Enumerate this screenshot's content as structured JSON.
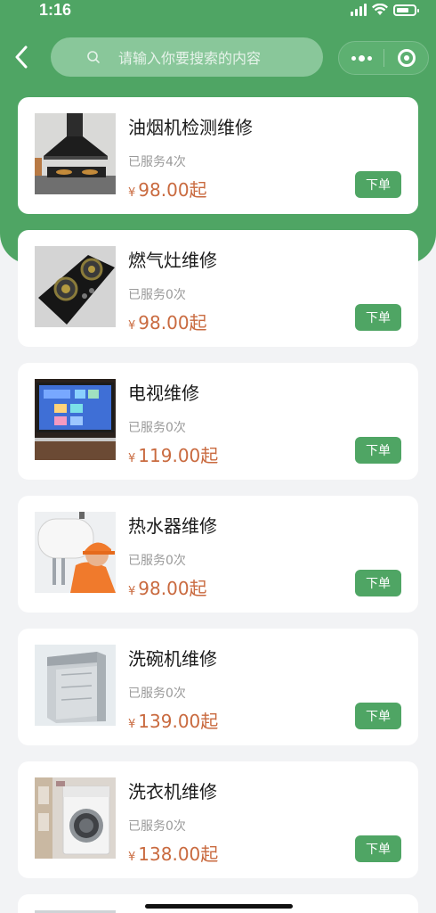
{
  "status_bar": {
    "time": "1:16"
  },
  "header": {
    "back_icon": "chevron-left-icon",
    "search": {
      "placeholder": "请输入你要搜索的内容",
      "icon": "search-icon"
    },
    "capsule": {
      "more_icon": "more-dots-icon",
      "close_icon": "target-icon"
    },
    "accent_color": "#4fa564"
  },
  "services": [
    {
      "title": "油烟机检测维修",
      "served": "已服务4次",
      "currency": "¥",
      "price": "98.00起",
      "button": "下单",
      "image": "range-hood"
    },
    {
      "title": "燃气灶维修",
      "served": "已服务0次",
      "currency": "¥",
      "price": "98.00起",
      "button": "下单",
      "image": "gas-stove"
    },
    {
      "title": "电视维修",
      "served": "已服务0次",
      "currency": "¥",
      "price": "119.00起",
      "button": "下单",
      "image": "television"
    },
    {
      "title": "热水器维修",
      "served": "已服务0次",
      "currency": "¥",
      "price": "98.00起",
      "button": "下单",
      "image": "water-heater"
    },
    {
      "title": "洗碗机维修",
      "served": "已服务0次",
      "currency": "¥",
      "price": "139.00起",
      "button": "下单",
      "image": "dishwasher"
    },
    {
      "title": "洗衣机维修",
      "served": "已服务0次",
      "currency": "¥",
      "price": "138.00起",
      "button": "下单",
      "image": "washing-machine"
    }
  ],
  "price_color": "#c96a3f"
}
